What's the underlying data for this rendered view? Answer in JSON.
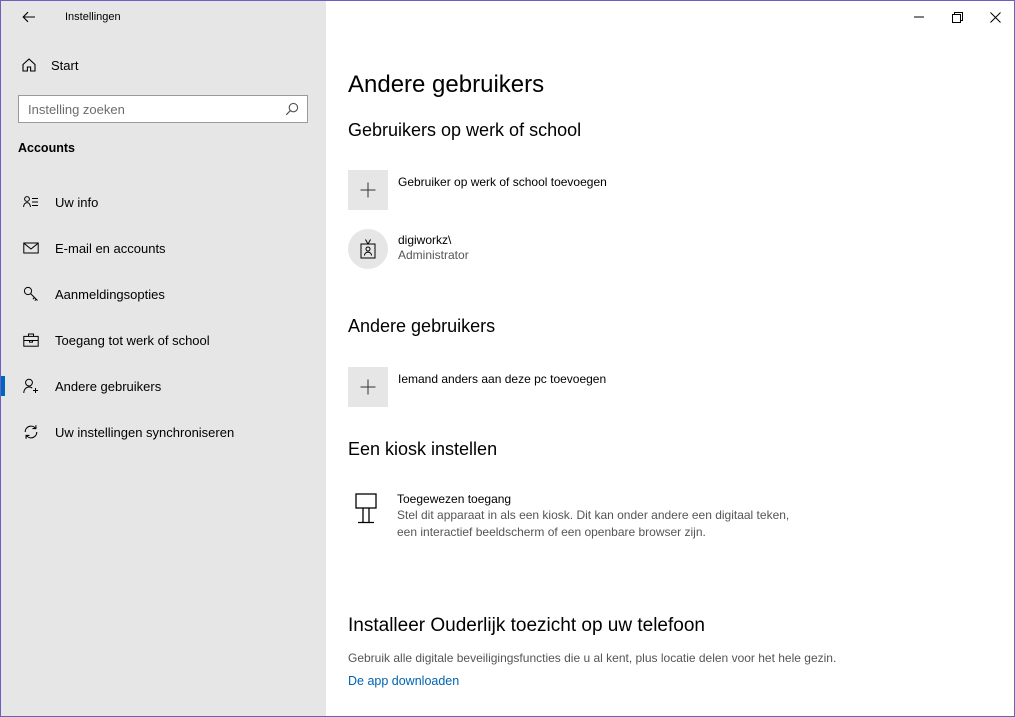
{
  "window": {
    "title": "Instellingen",
    "controls": {
      "minimize": "minimize-icon",
      "restore": "restore-icon",
      "close": "close-icon"
    }
  },
  "sidebar": {
    "home_label": "Start",
    "search_placeholder": "Instelling zoeken",
    "section_label": "Accounts",
    "items": [
      {
        "label": "Uw info",
        "icon": "user-info-icon",
        "active": false
      },
      {
        "label": "E-mail en accounts",
        "icon": "mail-icon",
        "active": false
      },
      {
        "label": "Aanmeldingsopties",
        "icon": "key-icon",
        "active": false
      },
      {
        "label": "Toegang tot werk of school",
        "icon": "briefcase-icon",
        "active": false
      },
      {
        "label": "Andere gebruikers",
        "icon": "add-user-icon",
        "active": true
      },
      {
        "label": "Uw instellingen synchroniseren",
        "icon": "sync-icon",
        "active": false
      }
    ]
  },
  "main": {
    "title": "Andere gebruikers",
    "work_school": {
      "heading": "Gebruikers op werk of school",
      "add_label": "Gebruiker op werk of school toevoegen",
      "user": {
        "name": "digiworkz\\",
        "role": "Administrator"
      }
    },
    "other_users": {
      "heading": "Andere gebruikers",
      "add_label": "Iemand anders aan deze pc toevoegen"
    },
    "kiosk": {
      "heading": "Een kiosk instellen",
      "title": "Toegewezen toegang",
      "description": "Stel dit apparaat in als een kiosk. Dit kan onder andere een digitaal teken, een interactief beeldscherm of een openbare browser zijn."
    },
    "parental": {
      "heading": "Installeer Ouderlijk toezicht op uw telefoon",
      "description": "Gebruik alle digitale beveiligingsfuncties die u al kent, plus locatie delen voor het hele gezin.",
      "link": "De app downloaden"
    }
  },
  "colors": {
    "accent": "#0067c0",
    "link": "#0063b1",
    "sidebar_bg": "#e6e6e6"
  }
}
